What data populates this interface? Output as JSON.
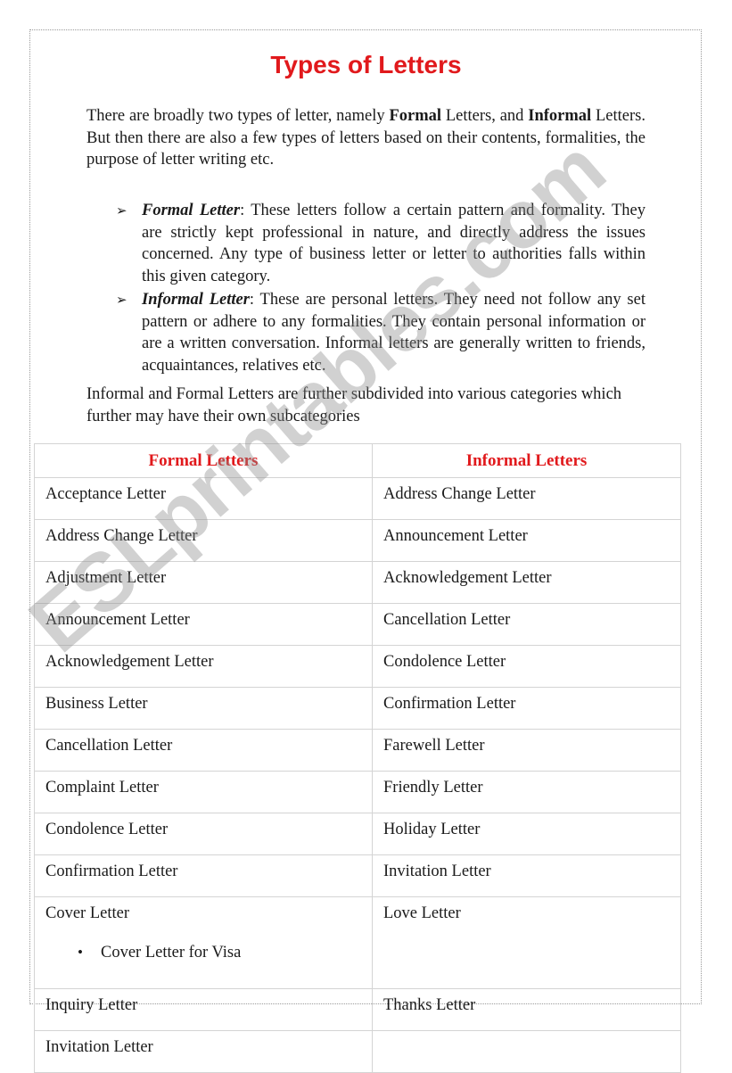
{
  "document": {
    "title": "Types of Letters",
    "title_color": "#e1191c",
    "watermark": "ESLprintables.com",
    "intro_paragraph": {
      "part1": "There are broadly two types of letter, namely ",
      "bold1": "Formal",
      "part2": " Letters, and ",
      "bold2": "Informal",
      "part3": " Letters. But then there are also a few types of letters based on their contents, formalities, the purpose of letter writing etc."
    },
    "bullets": [
      {
        "marker": "➢",
        "term": "Formal Letter",
        "text": ": These letters follow a certain pattern and formality. They are strictly kept professional in nature, and directly address the issues concerned. Any type of business letter or letter to authorities falls within this given category."
      },
      {
        "marker": "➢",
        "term": "Informal Letter",
        "text": ": These are personal letters. They need not follow any set pattern or adhere to any formalities. They contain personal information or are a written conversation. Informal letters are generally written to friends, acquaintances, relatives etc."
      }
    ],
    "closing_paragraph": "Informal and Formal Letters are further subdivided into various categories which further may have their own subcategories"
  },
  "table": {
    "headers": [
      "Formal Letters",
      "Informal Letters"
    ],
    "header_color": "#e1191c",
    "rows": [
      {
        "formal": "Acceptance Letter",
        "informal": "Address Change Letter"
      },
      {
        "formal": "Address Change Letter",
        "informal": "Announcement Letter"
      },
      {
        "formal": "Adjustment Letter",
        "informal": "Acknowledgement Letter"
      },
      {
        "formal": "Announcement Letter",
        "informal": "Cancellation Letter"
      },
      {
        "formal": "Acknowledgement Letter",
        "informal": "Condolence Letter"
      },
      {
        "formal": "Business Letter",
        "informal": "Confirmation Letter"
      },
      {
        "formal": "Cancellation Letter",
        "informal": "Farewell Letter"
      },
      {
        "formal": "Complaint Letter",
        "informal": "Friendly Letter"
      },
      {
        "formal": "Condolence Letter",
        "informal": "Holiday Letter"
      },
      {
        "formal": "Confirmation Letter",
        "informal": "Invitation Letter"
      }
    ],
    "cover_row": {
      "formal": "Cover Letter",
      "sub_bullet_marker": "•",
      "sub_bullet": "Cover Letter for Visa",
      "informal": "Love Letter"
    },
    "tail_rows": [
      {
        "formal": "Inquiry Letter",
        "informal": "Thanks Letter"
      },
      {
        "formal": "Invitation Letter",
        "informal": ""
      }
    ]
  }
}
